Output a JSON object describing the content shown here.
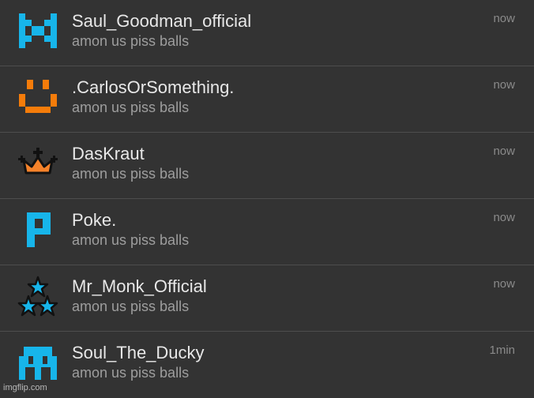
{
  "notifications": [
    {
      "name": "Saul_Goodman_official",
      "message": "amon us piss balls",
      "time": "now",
      "icon": "blue-pixel-x-icon"
    },
    {
      "name": ".CarlosOrSomething.",
      "message": "amon us piss balls",
      "time": "now",
      "icon": "orange-pixel-smile-icon"
    },
    {
      "name": "DasKraut",
      "message": "amon us piss balls",
      "time": "now",
      "icon": "orange-crown-icon"
    },
    {
      "name": "Poke.",
      "message": "amon us piss balls",
      "time": "now",
      "icon": "blue-pixel-p-icon"
    },
    {
      "name": "Mr_Monk_Official",
      "message": "amon us piss balls",
      "time": "now",
      "icon": "blue-stars-icon"
    },
    {
      "name": "Soul_The_Ducky",
      "message": "amon us piss balls",
      "time": "1min",
      "icon": "blue-pixel-invader-icon"
    }
  ],
  "watermark": "imgflip.com",
  "colors": {
    "background": "#333333",
    "divider": "#4d4d4d",
    "name": "#e8e8e8",
    "message": "#9e9e9e",
    "blue": "#17b5ea",
    "orange": "#f57c0a"
  }
}
